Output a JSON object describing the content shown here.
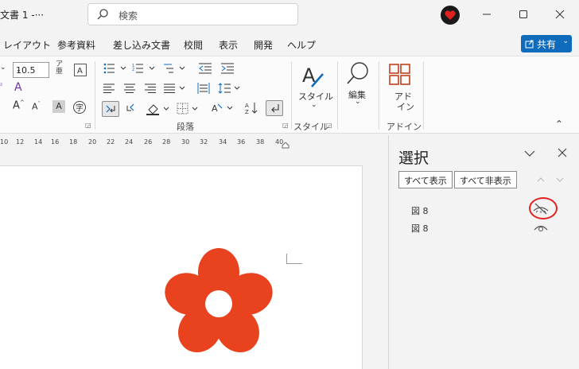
{
  "titlebar": {
    "doc_title": "文書 1  -···",
    "search_placeholder": "検索"
  },
  "menu": {
    "items": [
      "レイアウト",
      "参考資料",
      "差し込み文書",
      "校閲",
      "表示",
      "開発",
      "ヘルプ"
    ],
    "share_label": "共有",
    "accent": "#0f6cbd"
  },
  "ribbon": {
    "font_size": "10.5",
    "groups": {
      "paragraph": "段落",
      "style": "スタイル",
      "addin": "アドイン"
    },
    "buttons": {
      "style": "スタイル",
      "edit": "編集",
      "addin_line1": "アド",
      "addin_line2": "イン"
    }
  },
  "ruler": {
    "ticks": [
      "10",
      "12",
      "14",
      "16",
      "18",
      "20",
      "22",
      "24",
      "26",
      "28",
      "30",
      "32",
      "34",
      "36",
      "38",
      "40"
    ]
  },
  "selection_pane": {
    "title": "選択",
    "show_all": "すべて表示",
    "hide_all": "すべて非表示",
    "items": [
      {
        "label": "図 8",
        "visible": false
      },
      {
        "label": "図 8",
        "visible": true
      }
    ],
    "highlight_color": "#e52020"
  },
  "document": {
    "flower_color": "#e8431e"
  }
}
